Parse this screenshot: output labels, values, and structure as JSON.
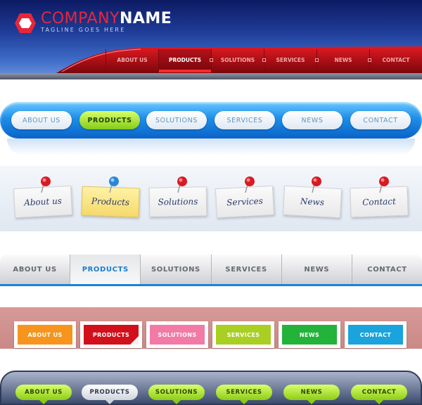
{
  "header": {
    "brand_part1": "COMPANY",
    "brand_part2": "NAME",
    "tagline": "TAGLINE GOES HERE",
    "logo_icon": "red-hexagon-icon",
    "nav": [
      "ABOUT US",
      "PRODUCTS",
      "SOLUTIONS",
      "SERVICES",
      "NEWS",
      "CONTACT"
    ],
    "active": "PRODUCTS",
    "accent": "#e8263a"
  },
  "blue_pills": {
    "items": [
      "ABOUT US",
      "PRODUCTS",
      "SOLUTIONS",
      "SERVICES",
      "NEWS",
      "CONTACT"
    ],
    "active": "PRODUCTS",
    "active_color": "#9cdf2a"
  },
  "sticky_notes": {
    "items": [
      "About us",
      "Products",
      "Solutions",
      "Services",
      "News",
      "Contact"
    ],
    "active": "Products",
    "pin_icons": [
      "red-pushpin-icon",
      "blue-pushpin-icon",
      "red-pushpin-icon",
      "red-pushpin-icon",
      "red-pushpin-icon",
      "red-pushpin-icon"
    ]
  },
  "gray_tabs": {
    "items": [
      "ABOUT US",
      "PRODUCTS",
      "SOLUTIONS",
      "SERVICES",
      "NEWS",
      "CONTACT"
    ],
    "active": "PRODUCTS",
    "active_color": "#1a7ed0"
  },
  "color_boxes": {
    "items": [
      {
        "label": "ABOUT US",
        "color": "#f7941d"
      },
      {
        "label": "PRODUCTS",
        "color": "#d2101b"
      },
      {
        "label": "SOLUTIONS",
        "color": "#f27aa5"
      },
      {
        "label": "SERVICES",
        "color": "#a8cf22"
      },
      {
        "label": "NEWS",
        "color": "#23b33a"
      },
      {
        "label": "CONTACT",
        "color": "#1aa3dd"
      }
    ],
    "active": "PRODUCTS"
  },
  "green_pills": {
    "items": [
      "ABOUT US",
      "PRODUCTS",
      "SOLUTIONS",
      "SERVICES",
      "NEWS",
      "CONTACT"
    ],
    "active": "PRODUCTS"
  }
}
